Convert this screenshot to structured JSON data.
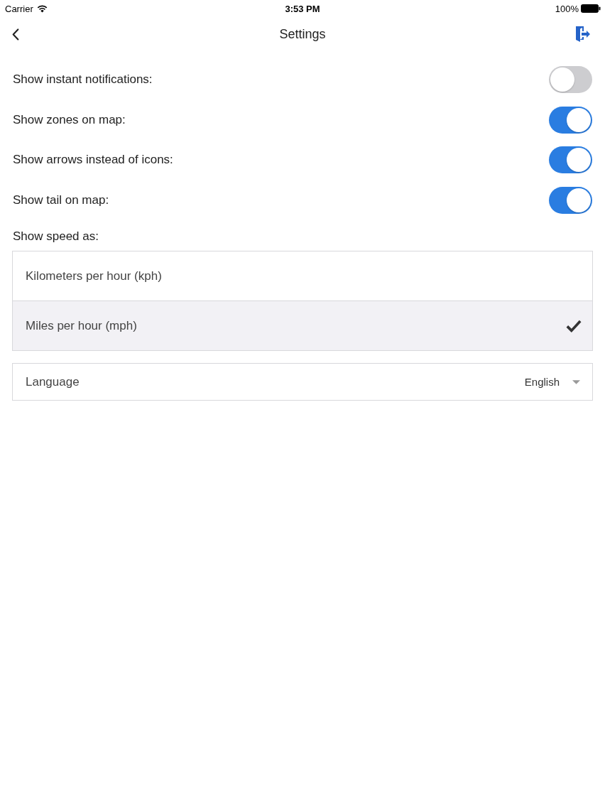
{
  "status_bar": {
    "carrier": "Carrier",
    "time": "3:53 PM",
    "battery": "100%"
  },
  "nav_bar": {
    "title": "Settings"
  },
  "toggles": [
    {
      "label": "Show instant notifications:",
      "on": false
    },
    {
      "label": "Show zones on map:",
      "on": true
    },
    {
      "label": "Show arrows instead of icons:",
      "on": true
    },
    {
      "label": "Show tail on map:",
      "on": true
    }
  ],
  "speed": {
    "label": "Show speed as:",
    "options": [
      {
        "label": "Kilometers per hour (kph)",
        "selected": false
      },
      {
        "label": "Miles per hour (mph)",
        "selected": true
      }
    ]
  },
  "language": {
    "label": "Language",
    "value": "English"
  }
}
